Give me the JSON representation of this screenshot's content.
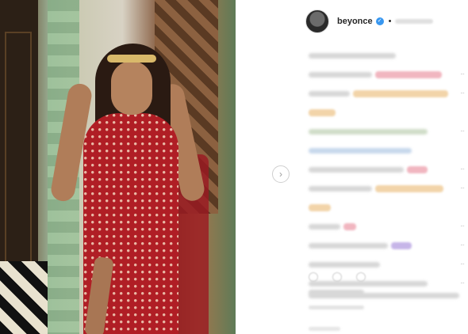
{
  "post": {
    "username": "beyonce",
    "verified_badge": "✓",
    "header_separator": "•"
  },
  "ui": {
    "next_arrow": "›",
    "more_menu": "···"
  },
  "icons": [
    "verified-icon",
    "chevron-right-icon",
    "kebab-menu-icon",
    "heart-icon",
    "comment-icon",
    "share-icon"
  ],
  "colors": {
    "verified": "#3897f0",
    "text": "#262626",
    "dress": "#b01e25"
  }
}
